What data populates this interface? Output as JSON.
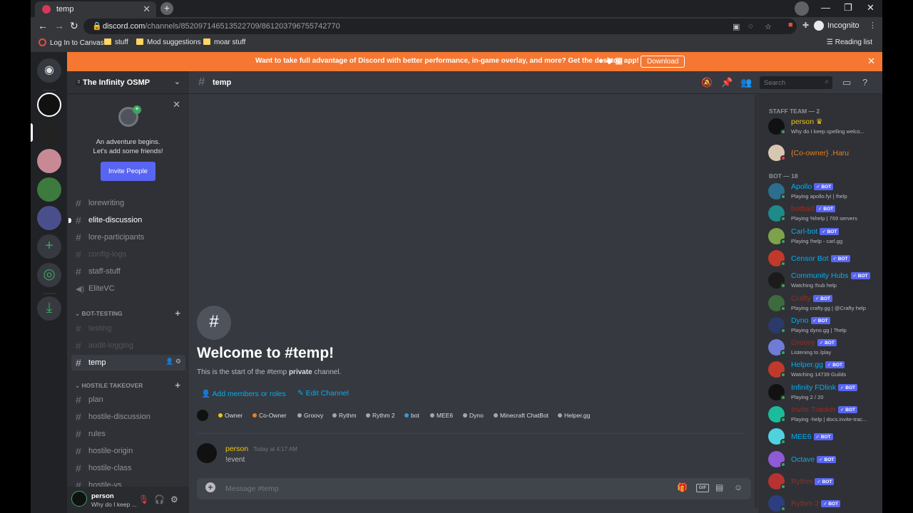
{
  "browser": {
    "tab_title": "temp",
    "url_host": "discord.com",
    "url_path": "/channels/852097146513522709/861203796755742770",
    "incognito_label": "Incognito",
    "bookmarks": [
      "Log In to Canvas",
      "stuff",
      "Mod suggestions",
      "moar stuff"
    ],
    "reading_list": "Reading list",
    "ext_badge": "12"
  },
  "banner": {
    "message": "Want to take full advantage of Discord with better performance, in-game overlay, and more? Get the desktop app!",
    "download_label": "Download"
  },
  "server": {
    "name": "The Infinity OSMP",
    "boost_level": "0",
    "invite_text_1": "An adventure begins.",
    "invite_text_2": "Let's add some friends!",
    "invite_button": "Invite People"
  },
  "channels": {
    "c1": "lorewriting",
    "c2": "elite-discussion",
    "c3": "lore-participants",
    "c4": "config-logs",
    "c5": "staff-stuff",
    "c6": "EliteVC",
    "cat1": "BOT-TESTING",
    "c7": "testing",
    "c8": "audit-logging",
    "c9": "temp",
    "cat2": "HOSTILE TAKEOVER",
    "c10": "plan",
    "c11": "hostile-discussion",
    "c12": "rules",
    "c13": "hostile-origin",
    "c14": "hostile-class",
    "c15": "hostile-vs"
  },
  "user": {
    "name": "person",
    "status": "Why do I keep ..."
  },
  "header": {
    "channel": "temp",
    "search_placeholder": "Search"
  },
  "welcome": {
    "title": "Welcome to #temp!",
    "sub_pre": "This is the start of the #temp ",
    "sub_bold": "private",
    "sub_post": " channel.",
    "add_members": "Add members or roles",
    "edit_channel": "Edit Channel"
  },
  "roles": [
    {
      "name": "Owner",
      "color": "#f1c40f"
    },
    {
      "name": "Co-Owner",
      "color": "#e67e22"
    },
    {
      "name": "Groovy",
      "color": "#99aab5"
    },
    {
      "name": "Rythm",
      "color": "#99aab5"
    },
    {
      "name": "Rythm 2",
      "color": "#99aab5"
    },
    {
      "name": "bot",
      "color": "#3498db"
    },
    {
      "name": "MEE6",
      "color": "#99aab5"
    },
    {
      "name": "Dyno",
      "color": "#99aab5"
    },
    {
      "name": "Minecraft ChatBot",
      "color": "#99aab5"
    },
    {
      "name": "Helper.gg",
      "color": "#99aab5"
    }
  ],
  "message": {
    "author": "person",
    "timestamp": "Today at 4:17 AM",
    "text": "!event"
  },
  "composer": {
    "placeholder": "Message #temp",
    "gif": "GIF"
  },
  "members": {
    "staff_header": "STAFF TEAM — 2",
    "bot_header": "BOT — 18",
    "bot_badge": "✓ BOT",
    "staff": [
      {
        "name": "person",
        "sub": "Why do I keep spelling welco...",
        "color": "#f1c40f"
      },
      {
        "name": "{Co-owner} .Haru",
        "sub": "",
        "color": "#e67e22"
      }
    ],
    "bots": [
      {
        "name": "Apollo",
        "sub": "Playing apollo.fyi | !help",
        "color": "#00b0f4"
      },
      {
        "name": "botbad",
        "sub": "Playing %help | 769 servers",
        "color": "#992d22"
      },
      {
        "name": "Carl-bot",
        "sub": "Playing !help - carl.gg",
        "color": "#00b0f4"
      },
      {
        "name": "Censor Bot",
        "sub": "",
        "color": "#00b0f4"
      },
      {
        "name": "Community Hubs",
        "sub": "Watching !hub help",
        "color": "#00b0f4"
      },
      {
        "name": "Crafty",
        "sub": "Playing crafty.gg | @Crafty help",
        "color": "#992d22"
      },
      {
        "name": "Dyno",
        "sub": "Playing dyno.gg | ?help",
        "color": "#00b0f4"
      },
      {
        "name": "Groovy",
        "sub": "Listening to /play",
        "color": "#992d22"
      },
      {
        "name": "Helper.gg",
        "sub": "Watching 14739 Guilds",
        "color": "#00b0f4"
      },
      {
        "name": "Infinity FDlink",
        "sub": "Playing 2 / 20",
        "color": "#00b0f4"
      },
      {
        "name": "Invite Tracker",
        "sub": "Playing -help | docs.invite-trac...",
        "color": "#992d22"
      },
      {
        "name": "MEE6",
        "sub": "",
        "color": "#00b0f4"
      },
      {
        "name": "Octave",
        "sub": "",
        "color": "#00b0f4"
      },
      {
        "name": "Rythm",
        "sub": "",
        "color": "#992d22"
      },
      {
        "name": "Rythm 2",
        "sub": "",
        "color": "#992d22"
      }
    ]
  }
}
